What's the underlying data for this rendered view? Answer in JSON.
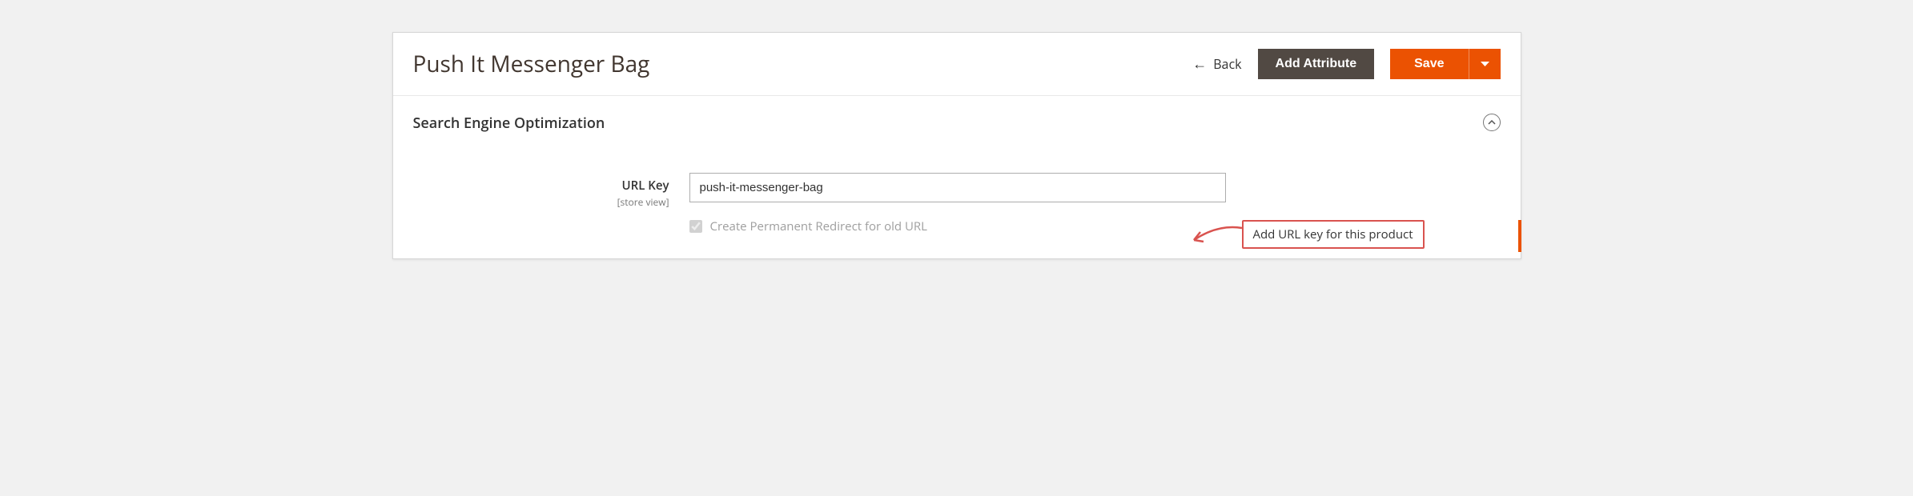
{
  "header": {
    "title": "Push It Messenger Bag",
    "back_label": "Back",
    "add_attribute_label": "Add Attribute",
    "save_label": "Save"
  },
  "section": {
    "title": "Search Engine Optimization",
    "url_key": {
      "label": "URL Key",
      "scope": "[store view]",
      "value": "push-it-messenger-bag"
    },
    "redirect_label": "Create Permanent Redirect for old URL"
  },
  "annotation": {
    "text": "Add URL key for this product"
  }
}
